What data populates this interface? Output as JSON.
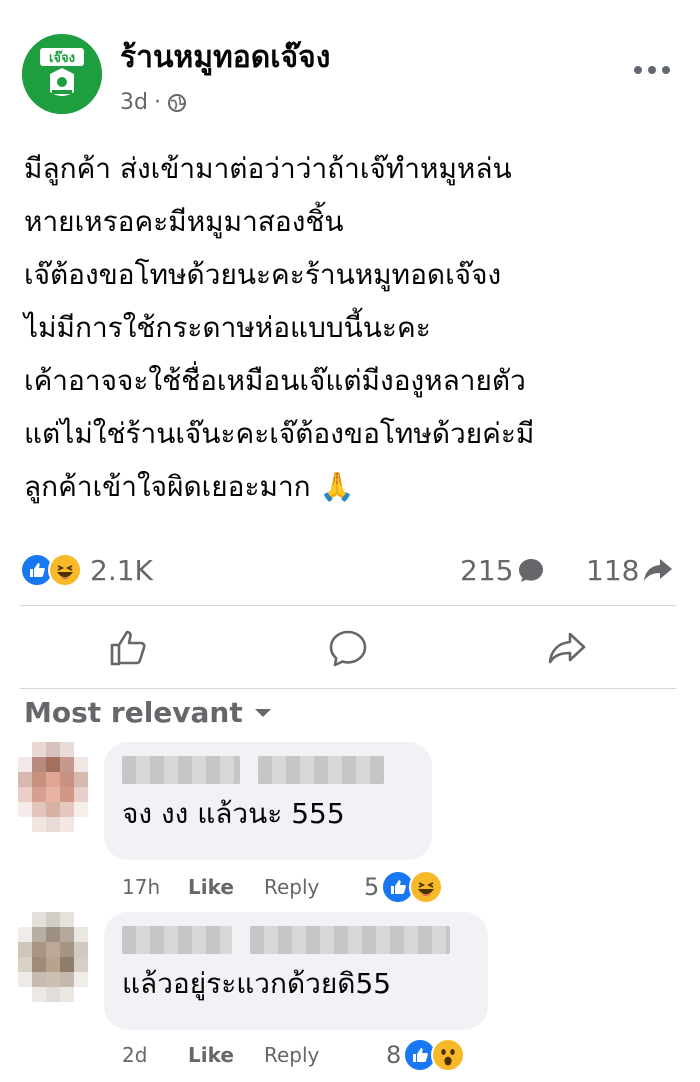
{
  "post": {
    "page_name": "ร้านหมูทอดเจ๊จง",
    "avatar_text": "เจ๊จง",
    "time": "3d",
    "separator": "·",
    "body": "มีลูกค้า ส่งเข้ามาต่อว่าว่าถ้าเจ๊ทำหมูหล่น\nหายเหรอคะมีหมูมาสองชิ้น\nเจ๊ต้องขอโทษด้วยนะคะร้านหมูทอดเจ๊จง\nไม่มีการใช้กระดาษห่อแบบนี้นะคะ\nเค้าอาจจะใช้ชื่อเหมือนเจ๊แต่มีงองูหลายตัว\nแต่ไม่ใช่ร้านเจ๊นะคะเจ๊ต้องขอโทษด้วยค่ะมี\nลูกค้าเข้าใจผิดเยอะมาก 🙏"
  },
  "stats": {
    "reactions_count": "2.1K",
    "comments_count": "215",
    "shares_count": "118"
  },
  "sort_label": "Most relevant",
  "comments": [
    {
      "text": "จง งง แล้วนะ 555",
      "time": "17h",
      "like": "Like",
      "reply": "Reply",
      "reaction_count": "5",
      "reactions": [
        "like",
        "haha"
      ]
    },
    {
      "text": "แล้วอยู่ระแวกด้วยดิ55",
      "time": "2d",
      "like": "Like",
      "reply": "Reply",
      "reaction_count": "8",
      "reactions": [
        "like",
        "wow"
      ]
    }
  ],
  "colors": {
    "brand_green": "#1f9e3f",
    "like_blue": "#1877f2",
    "haha_yellow": "#f7b928",
    "muted": "#65676b"
  }
}
